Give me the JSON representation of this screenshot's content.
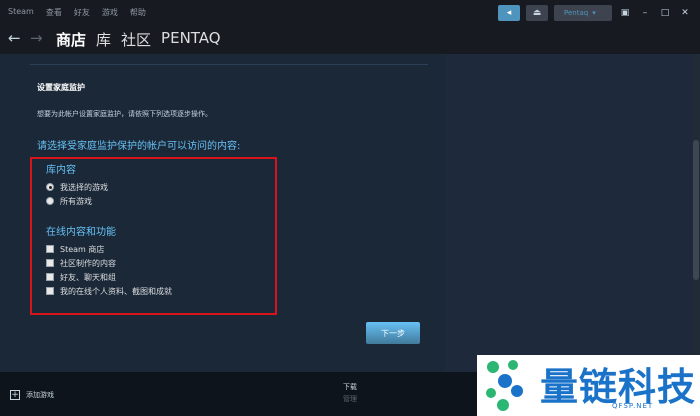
{
  "titlebar": {
    "app_name": "Steam",
    "menu": [
      "查看",
      "好友",
      "游戏",
      "帮助"
    ],
    "account_label": "Pentaq"
  },
  "nav": {
    "tabs": [
      "商店",
      "库",
      "社区",
      "PENTAQ"
    ],
    "active_tab": "商店"
  },
  "content": {
    "heading": "设置家庭监护",
    "description": "想要为此帐户设置家庭监护，请依照下列选项逐步操作。",
    "prompt": "请选择受家庭监护保护的帐户可以访问的内容:",
    "library_title": "库内容",
    "library_options": [
      "我选择的游戏",
      "所有游戏"
    ],
    "library_selected": 0,
    "online_title": "在线内容和功能",
    "online_options": [
      "Steam 商店",
      "社区制作的内容",
      "好友、聊天和组",
      "我的在线个人资料、截图和成就"
    ],
    "next_button": "下一步"
  },
  "bottom": {
    "add_game": "添加游戏",
    "download_label": "下载",
    "download_sub": "管理"
  },
  "watermark": {
    "text": "量链科技",
    "domain": "QFSP.NET"
  },
  "colors": {
    "accent": "#66c0f4",
    "highlight_border": "#d7141b",
    "background": "#1b2838"
  }
}
